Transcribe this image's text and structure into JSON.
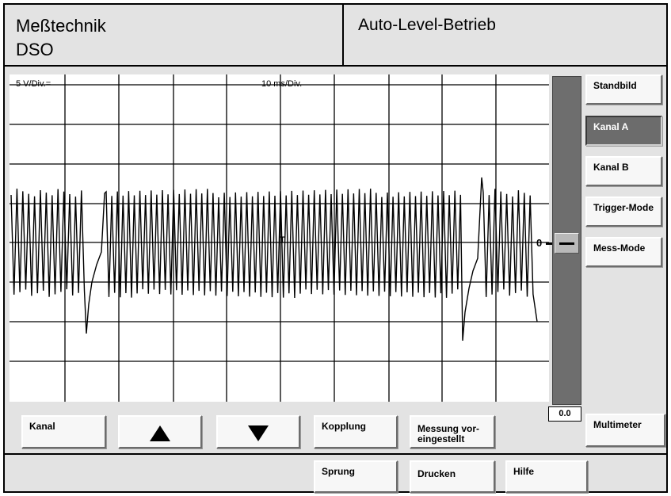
{
  "header": {
    "title_line1": "Meßtechnik",
    "title_line2": "DSO",
    "mode": "Auto-Level-Betrieb"
  },
  "scope": {
    "volts_per_div": "5 V/Div.=",
    "time_per_div": "10 ms/Div.",
    "trigger_marker": "T",
    "zero_level_marker": "0",
    "grid_on": true,
    "trace_color": "#000000",
    "background": "#ffffff"
  },
  "level_slider": {
    "value": "0.0"
  },
  "side_buttons": [
    {
      "label": "Standbild",
      "active": false
    },
    {
      "label": "Kanal A",
      "active": true
    },
    {
      "label": "Kanal B",
      "active": false
    },
    {
      "label": "Trigger-Mode",
      "active": false
    },
    {
      "label": "Mess-Mode",
      "active": false
    },
    {
      "label": "Multimeter",
      "active": false
    }
  ],
  "bottom_row1": {
    "kanal": "Kanal",
    "up_icon": "arrow-up-icon",
    "down_icon": "arrow-down-icon",
    "kopplung": "Kopplung",
    "messung_line1": "Messung vor-",
    "messung_line2": "eingestellt"
  },
  "bottom_row2": {
    "sprung": "Sprung",
    "drucken": "Drucken",
    "hilfe": "Hilfe"
  },
  "colors": {
    "panel": "#e3e3e3",
    "active_button": "#6c6c6c",
    "slider_track": "#6e6e6e"
  }
}
